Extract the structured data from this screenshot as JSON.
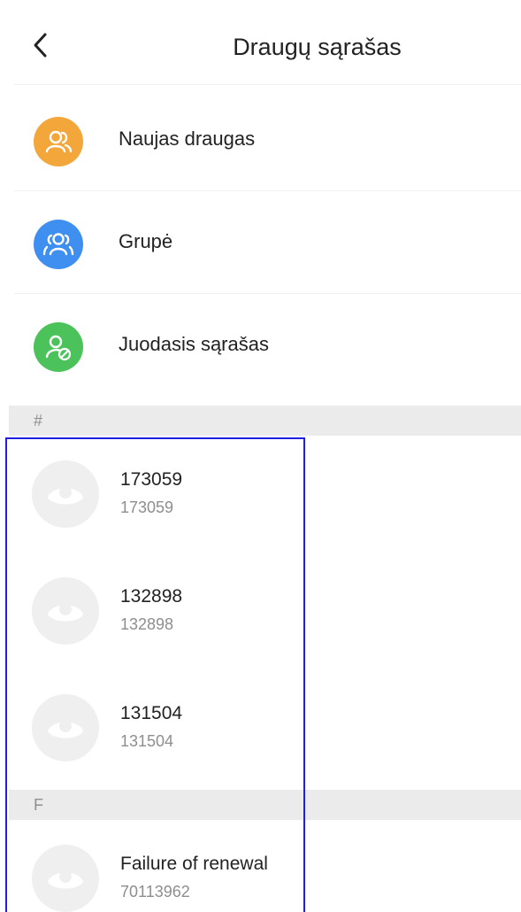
{
  "header": {
    "title": "Draugų sąrašas"
  },
  "menu": [
    {
      "label": "Naujas draugas",
      "color": "#f3a73b",
      "icon": "new-friend-icon"
    },
    {
      "label": "Grupė",
      "color": "#3f8ff0",
      "icon": "group-icon"
    },
    {
      "label": "Juodasis sąrašas",
      "color": "#4cc35a",
      "icon": "blacklist-icon"
    }
  ],
  "sections": [
    {
      "letter": "#",
      "contacts": [
        {
          "name": "173059",
          "id": "173059"
        },
        {
          "name": "132898",
          "id": "132898"
        },
        {
          "name": "131504",
          "id": "131504"
        }
      ]
    },
    {
      "letter": "F",
      "contacts": [
        {
          "name": "Failure of renewal",
          "id": "70113962"
        }
      ]
    }
  ],
  "colors": {
    "selection_box": "#1f1fe0",
    "section_bg": "#ebebeb"
  }
}
